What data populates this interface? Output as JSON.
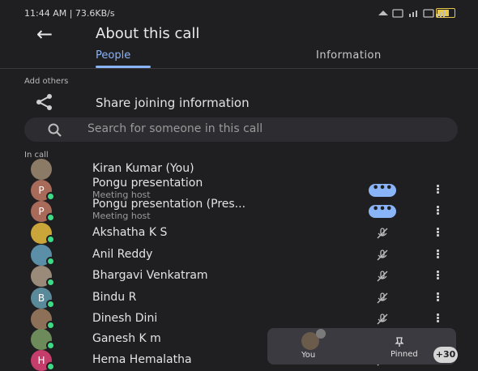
{
  "status_bar": {
    "time_text": "11:44 AM | 73.6KB/s",
    "right_icons": "wifi sim signal battery"
  },
  "header": {
    "title": "About this call",
    "back_icon": "arrow-left-icon"
  },
  "tabs": [
    {
      "label": "People",
      "selected": true
    },
    {
      "label": "Information",
      "selected": false
    }
  ],
  "add_others": {
    "section_label": "Add others",
    "share_label": "Share joining information",
    "search_placeholder": "Search for someone in this call"
  },
  "in_call": {
    "section_label": "In call",
    "participants": [
      {
        "name": "Kiran Kumar (You)",
        "subtitle": "",
        "avatar": "photo",
        "avatar_color": "#8a7a66",
        "status": "none"
      },
      {
        "name": "Pongu presentation",
        "subtitle": "Meeting host",
        "avatar": "P",
        "avatar_color": "#a86b5a",
        "status": "active"
      },
      {
        "name": "Pongu presentation (Pres...",
        "subtitle": "Meeting host",
        "avatar": "P",
        "avatar_color": "#a86b5a",
        "status": "active"
      },
      {
        "name": "Akshatha K S",
        "subtitle": "",
        "avatar": "photo",
        "avatar_color": "#c9a53a",
        "status": "muted"
      },
      {
        "name": "Anil Reddy",
        "subtitle": "",
        "avatar": "photo",
        "avatar_color": "#5b8fa8",
        "status": "muted"
      },
      {
        "name": "Bhargavi Venkatram",
        "subtitle": "",
        "avatar": "photo",
        "avatar_color": "#9a8a7a",
        "status": "muted"
      },
      {
        "name": "Bindu R",
        "subtitle": "",
        "avatar": "B",
        "avatar_color": "#5a8a9a",
        "status": "muted"
      },
      {
        "name": "Dinesh Dini",
        "subtitle": "",
        "avatar": "photo",
        "avatar_color": "#8c7058",
        "status": "muted"
      },
      {
        "name": "Ganesh K m",
        "subtitle": "",
        "avatar": "photo",
        "avatar_color": "#6d8a5a",
        "status": "muted"
      },
      {
        "name": "Hema Hemalatha",
        "subtitle": "",
        "avatar": "H",
        "avatar_color": "#c43d6b",
        "status": "muted"
      }
    ]
  },
  "floating_panel": {
    "you_label": "You",
    "pinned_label": "Pinned",
    "count": "+30"
  },
  "colors": {
    "background": "#1f1f22",
    "accent": "#8ab4f8",
    "online": "#3ddc84"
  }
}
